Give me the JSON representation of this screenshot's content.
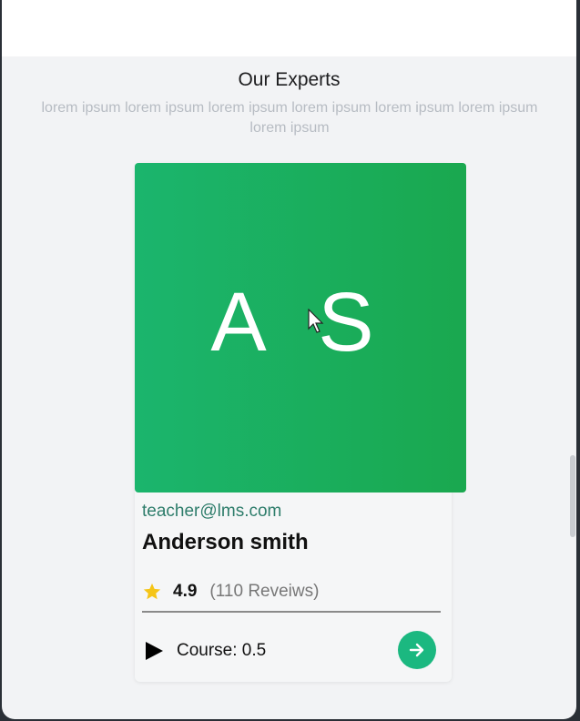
{
  "section": {
    "title": "Our Experts",
    "subtitle": "lorem ipsum lorem ipsum lorem ipsum lorem ipsum lorem ipsum lorem ipsum lorem ipsum"
  },
  "expert_card": {
    "initials": "A S",
    "email": "teacher@lms.com",
    "name": "Anderson smith",
    "rating": "4.9",
    "reviews": "(110 Reveiws)",
    "course": "Course: 0.5",
    "accent_color": "#1bb56d",
    "star_color": "#f5c518",
    "icons": {
      "star": "star-icon",
      "play": "play-icon",
      "arrow": "arrow-right-icon"
    }
  }
}
